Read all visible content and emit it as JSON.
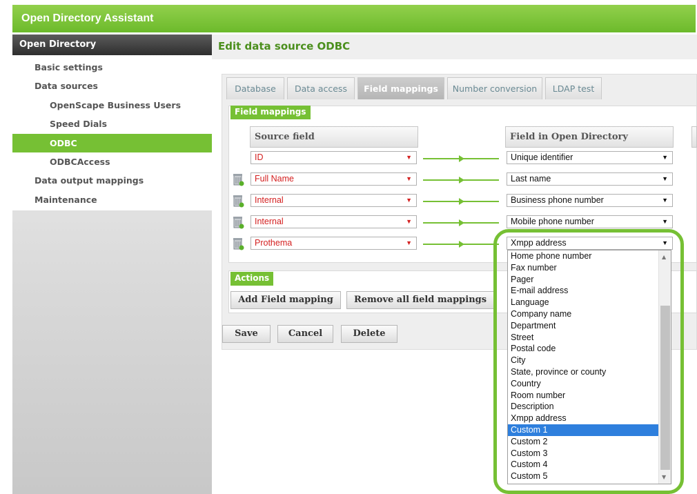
{
  "app": {
    "title": "Open Directory Assistant"
  },
  "sidebar": {
    "header": "Open Directory",
    "items": [
      {
        "label": "Basic settings"
      },
      {
        "label": "Data sources"
      },
      {
        "label": "OpenScape Business Users"
      },
      {
        "label": "Speed Dials"
      },
      {
        "label": "ODBC"
      },
      {
        "label": "ODBCAccess"
      },
      {
        "label": "Data output mappings"
      },
      {
        "label": "Maintenance"
      }
    ]
  },
  "page": {
    "title": "Edit data source ODBC"
  },
  "tabs": [
    {
      "label": "Database"
    },
    {
      "label": "Data access"
    },
    {
      "label": "Field mappings"
    },
    {
      "label": "Number conversion"
    },
    {
      "label": "LDAP test"
    }
  ],
  "field_mappings": {
    "section_label": "Field mappings",
    "col_source": "Source field",
    "col_target": "Field in Open Directory",
    "rows": [
      {
        "source": "ID",
        "target": "Unique identifier"
      },
      {
        "source": "Full Name",
        "target": "Last name"
      },
      {
        "source": "Internal",
        "target": "Business phone number"
      },
      {
        "source": "Internal",
        "target": "Mobile phone number"
      },
      {
        "source": "Prothema",
        "target": "Xmpp address"
      }
    ]
  },
  "actions": {
    "section_label": "Actions",
    "add_label": "Add Field mapping",
    "remove_all_label": "Remove all field mappings"
  },
  "form_buttons": {
    "save": "Save",
    "cancel": "Cancel",
    "delete": "Delete"
  },
  "dropdown": {
    "options": [
      "Home phone number",
      "Fax number",
      "Pager",
      "E-mail address",
      "Language",
      "Company name",
      "Department",
      "Street",
      "Postal code",
      "City",
      "State, province or county",
      "Country",
      "Room number",
      "Description",
      "Xmpp address",
      "Custom 1",
      "Custom 2",
      "Custom 3",
      "Custom 4",
      "Custom 5"
    ],
    "highlighted": "Custom 1"
  },
  "colors": {
    "accent": "#76c034",
    "selection": "#2e7fdd",
    "source_text": "#d42020"
  }
}
